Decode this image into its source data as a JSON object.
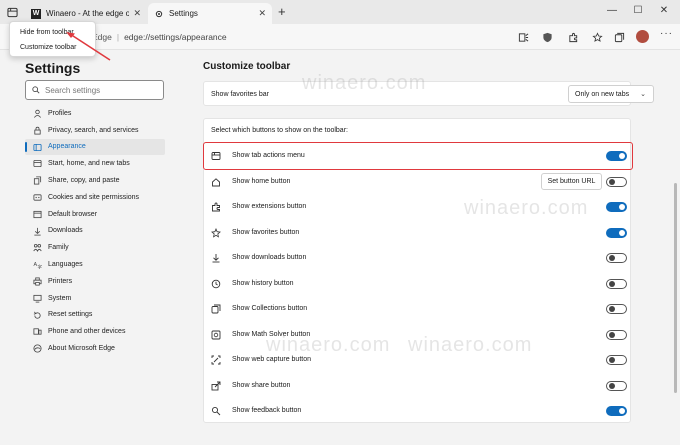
{
  "tabs": [
    {
      "title": "Winaero - At the edge of tweaki",
      "favicon": "W"
    },
    {
      "title": "Settings",
      "favicon": "gear"
    }
  ],
  "address": {
    "browser": "Edge",
    "url": "edge://settings/appearance"
  },
  "context_menu": {
    "items": [
      "Hide from toolbar",
      "Customize toolbar"
    ]
  },
  "sidebar": {
    "title": "Settings",
    "search_placeholder": "Search settings",
    "items": [
      {
        "label": "Profiles",
        "icon": "profile-icon"
      },
      {
        "label": "Privacy, search, and services",
        "icon": "lock-icon"
      },
      {
        "label": "Appearance",
        "icon": "appearance-icon",
        "active": true
      },
      {
        "label": "Start, home, and new tabs",
        "icon": "home-tabs-icon"
      },
      {
        "label": "Share, copy, and paste",
        "icon": "share-icon"
      },
      {
        "label": "Cookies and site permissions",
        "icon": "cookie-icon"
      },
      {
        "label": "Default browser",
        "icon": "browser-icon"
      },
      {
        "label": "Downloads",
        "icon": "download-icon"
      },
      {
        "label": "Family",
        "icon": "family-icon"
      },
      {
        "label": "Languages",
        "icon": "languages-icon"
      },
      {
        "label": "Printers",
        "icon": "printer-icon"
      },
      {
        "label": "System",
        "icon": "system-icon"
      },
      {
        "label": "Reset settings",
        "icon": "reset-icon"
      },
      {
        "label": "Phone and other devices",
        "icon": "phone-icon"
      },
      {
        "label": "About Microsoft Edge",
        "icon": "edge-icon"
      }
    ]
  },
  "main": {
    "title": "Customize toolbar",
    "favorites_bar": {
      "label": "Show favorites bar",
      "value": "Only on new tabs"
    },
    "section_head": "Select which buttons to show on the toolbar:",
    "set_url_label": "Set button URL",
    "rows": [
      {
        "label": "Show tab actions menu",
        "icon": "tab-actions-icon",
        "on": true,
        "highlight": true
      },
      {
        "label": "Show home button",
        "icon": "home-icon",
        "on": false,
        "set_url": true
      },
      {
        "label": "Show extensions button",
        "icon": "extensions-icon",
        "on": true
      },
      {
        "label": "Show favorites button",
        "icon": "favorites-icon",
        "on": true
      },
      {
        "label": "Show downloads button",
        "icon": "downloads-icon",
        "on": false
      },
      {
        "label": "Show history button",
        "icon": "history-icon",
        "on": false
      },
      {
        "label": "Show Collections button",
        "icon": "collections-icon",
        "on": false
      },
      {
        "label": "Show Math Solver button",
        "icon": "math-solver-icon",
        "on": false
      },
      {
        "label": "Show web capture button",
        "icon": "web-capture-icon",
        "on": false
      },
      {
        "label": "Show share button",
        "icon": "share-icon",
        "on": false
      },
      {
        "label": "Show feedback button",
        "icon": "feedback-icon",
        "on": true
      }
    ]
  },
  "watermark": "winaero.com",
  "colors": {
    "accent": "#0f6cbd",
    "highlight": "#e0393e",
    "annotation_arrow": "#e0393e"
  }
}
